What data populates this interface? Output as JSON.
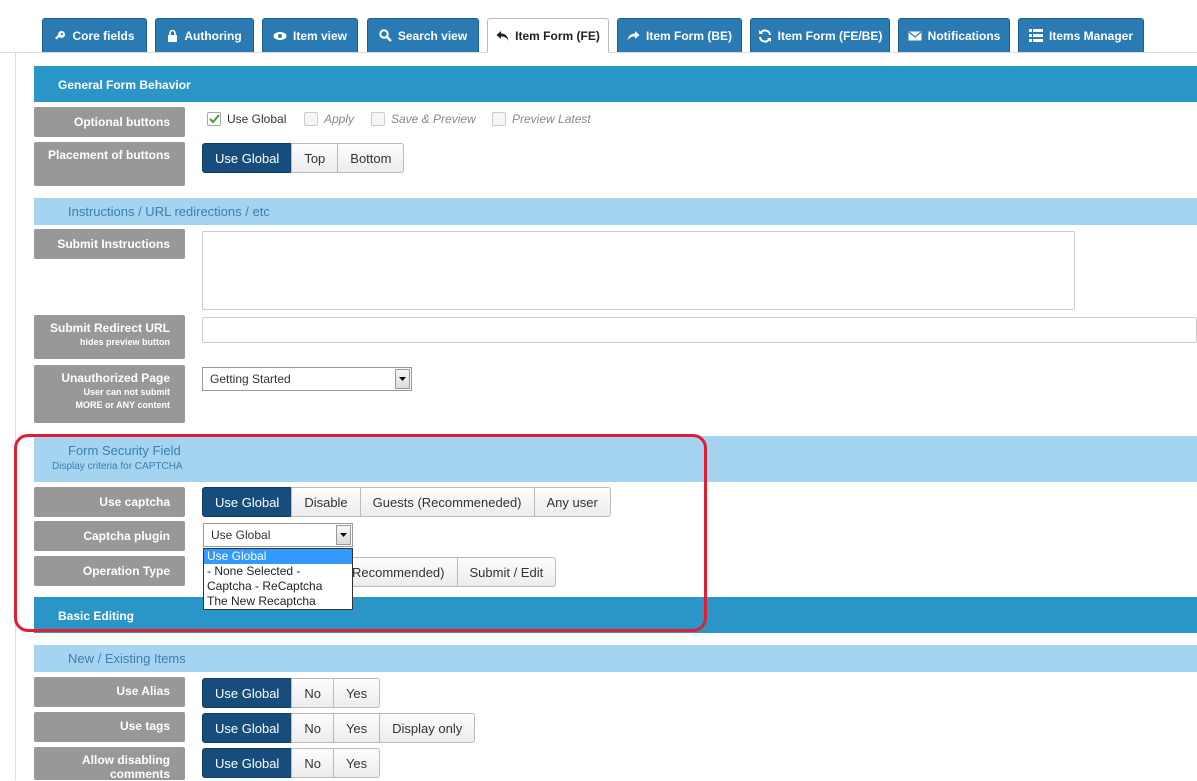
{
  "tabs": [
    {
      "label": "Core fields",
      "icon": "key-icon"
    },
    {
      "label": "Authoring",
      "icon": "lock-icon"
    },
    {
      "label": "Item view",
      "icon": "eye-icon"
    },
    {
      "label": "Search view",
      "icon": "search-icon"
    },
    {
      "label": "Item Form (FE)",
      "icon": "reply-icon"
    },
    {
      "label": "Item Form (BE)",
      "icon": "forward-icon"
    },
    {
      "label": "Item Form (FE/BE)",
      "icon": "refresh-icon"
    },
    {
      "label": "Notifications",
      "icon": "envelope-icon"
    },
    {
      "label": "Items Manager",
      "icon": "list-icon"
    }
  ],
  "active_tab": "Item Form (FE)",
  "general": {
    "title": "General Form Behavior",
    "optional_buttons": {
      "label": "Optional buttons",
      "options": [
        {
          "label": "Use Global",
          "checked": true
        },
        {
          "label": "Apply",
          "checked": false
        },
        {
          "label": "Save & Preview",
          "checked": false
        },
        {
          "label": "Preview Latest",
          "checked": false
        }
      ]
    },
    "placement": {
      "label": "Placement of buttons",
      "options": [
        "Use Global",
        "Top",
        "Bottom"
      ],
      "selected": "Use Global"
    }
  },
  "instructions": {
    "title": "Instructions / URL redirections / etc",
    "submit_instructions_label": "Submit Instructions",
    "submit_instructions_value": "",
    "redirect_label": "Submit Redirect URL",
    "redirect_sub": "hides preview button",
    "redirect_value": "",
    "unauth_label": "Unauthorized Page",
    "unauth_sub1": "User can not submit",
    "unauth_sub2": "MORE or ANY content",
    "unauth_value": "Getting Started"
  },
  "security": {
    "title": "Form Security Field",
    "subtitle": "Display criteria for CAPTCHA",
    "use_captcha": {
      "label": "Use captcha",
      "options": [
        "Use Global",
        "Disable",
        "Guests (Recommeneded)",
        "Any user"
      ],
      "selected": "Use Global"
    },
    "captcha_plugin": {
      "label": "Captcha plugin",
      "value": "Use Global",
      "options": [
        "Use Global",
        "- None Selected -",
        "Captcha - ReCaptcha",
        "The New Recaptcha"
      ],
      "highlighted": "Use Global"
    },
    "operation_type": {
      "label": "Operation Type",
      "visible_options": [
        "Recommended)",
        "Submit / Edit"
      ]
    }
  },
  "basic": {
    "title": "Basic Editing"
  },
  "new_existing": {
    "title": "New / Existing Items",
    "use_alias": {
      "label": "Use Alias",
      "options": [
        "Use Global",
        "No",
        "Yes"
      ],
      "selected": "Use Global"
    },
    "use_tags": {
      "label": "Use tags",
      "options": [
        "Use Global",
        "No",
        "Yes",
        "Display only"
      ],
      "selected": "Use Global"
    },
    "allow_disabling": {
      "label": "Allow disabling comments",
      "options": [
        "Use Global",
        "No",
        "Yes"
      ],
      "selected": "Use Global"
    }
  },
  "colors": {
    "tab_bg": "#2a7ab4",
    "section_dark": "#2a96c8",
    "section_light": "#a5d4f0",
    "selected_btn": "#174d7d",
    "highlight": "#e02030"
  }
}
